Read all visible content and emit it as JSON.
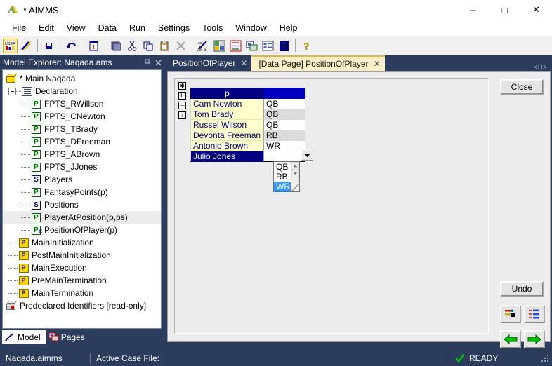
{
  "window": {
    "title": "* AIMMS",
    "app_icon": "aimms-logo-icon",
    "minimize": "─",
    "maximize": "□",
    "close": "✕"
  },
  "menu": {
    "items": [
      {
        "label": "File"
      },
      {
        "label": "Edit"
      },
      {
        "label": "View"
      },
      {
        "label": "Data"
      },
      {
        "label": "Run"
      },
      {
        "label": "Settings"
      },
      {
        "label": "Tools"
      },
      {
        "label": "Window"
      },
      {
        "label": "Help"
      }
    ]
  },
  "toolbar": {
    "groups": [
      {
        "buttons": [
          {
            "name": "user-colors-icon",
            "glyph": "USER",
            "selected": true
          },
          {
            "name": "pencil-tools-icon",
            "glyph": "✎"
          },
          {
            "name": "save-all-icon",
            "glyph": "⍈"
          },
          {
            "name": "undo-icon",
            "glyph": "↶"
          }
        ]
      },
      {
        "buttons": [
          {
            "name": "new-page-icon",
            "glyph": "1"
          },
          {
            "name": "open-folder-icon",
            "glyph": "❐"
          },
          {
            "name": "cut-icon",
            "glyph": "✂"
          },
          {
            "name": "copy-icon",
            "glyph": "⧉"
          },
          {
            "name": "paste-icon",
            "glyph": "ὌB"
          },
          {
            "name": "delete-icon",
            "glyph": "✕"
          }
        ]
      },
      {
        "buttons": [
          {
            "name": "math-program-icon",
            "glyph": "Ax"
          },
          {
            "name": "identifier-grid-icon",
            "glyph": "▒"
          },
          {
            "name": "model-tree-icon",
            "glyph": "⊞"
          },
          {
            "name": "page-manager-icon",
            "glyph": "▣"
          },
          {
            "name": "list-view-icon",
            "glyph": "☰"
          },
          {
            "name": "info-icon",
            "glyph": "i"
          }
        ]
      },
      {
        "buttons": [
          {
            "name": "help-icon",
            "glyph": "?"
          }
        ]
      }
    ]
  },
  "explorer": {
    "title": "Model Explorer: Naqada.ams",
    "pin_icon": "pin-icon",
    "close_icon": "close-icon",
    "tree": [
      {
        "label": "* Main Naqada",
        "icon": "model-box-icon",
        "depth": 0,
        "expander": false,
        "selected": false
      },
      {
        "label": "Declaration",
        "icon": "declaration-icon",
        "depth": 1,
        "expander": true,
        "selected": false
      },
      {
        "label": "FPTS_RWillson",
        "icon": "parameter-icon",
        "depth": 2,
        "expander": false,
        "selected": false
      },
      {
        "label": "FPTS_CNewton",
        "icon": "parameter-icon",
        "depth": 2,
        "expander": false,
        "selected": false
      },
      {
        "label": "FPTS_TBrady",
        "icon": "parameter-icon",
        "depth": 2,
        "expander": false,
        "selected": false
      },
      {
        "label": "FPTS_DFreeman",
        "icon": "parameter-icon",
        "depth": 2,
        "expander": false,
        "selected": false
      },
      {
        "label": "FPTS_ABrown",
        "icon": "parameter-icon",
        "depth": 2,
        "expander": false,
        "selected": false
      },
      {
        "label": "FPTS_JJones",
        "icon": "parameter-icon",
        "depth": 2,
        "expander": false,
        "selected": false
      },
      {
        "label": "Players",
        "icon": "set-icon",
        "depth": 2,
        "expander": false,
        "selected": false
      },
      {
        "label": "FantasyPoints(p)",
        "icon": "parameter-icon",
        "depth": 2,
        "expander": false,
        "selected": false
      },
      {
        "label": "Positions",
        "icon": "set-icon",
        "depth": 2,
        "expander": false,
        "selected": false
      },
      {
        "label": "PlayerAtPosition(p,ps)",
        "icon": "parameter-icon",
        "depth": 2,
        "expander": false,
        "selected": true
      },
      {
        "label": "PositionOfPlayer(p)",
        "icon": "element-parameter-icon",
        "depth": 2,
        "expander": false,
        "selected": false
      },
      {
        "label": "MainInitialization",
        "icon": "procedure-icon",
        "depth": 1,
        "expander": false,
        "selected": false
      },
      {
        "label": "PostMainInitialization",
        "icon": "procedure-icon",
        "depth": 1,
        "expander": false,
        "selected": false
      },
      {
        "label": "MainExecution",
        "icon": "procedure-icon",
        "depth": 1,
        "expander": false,
        "selected": false
      },
      {
        "label": "PreMainTermination",
        "icon": "procedure-icon",
        "depth": 1,
        "expander": false,
        "selected": false
      },
      {
        "label": "MainTermination",
        "icon": "procedure-icon",
        "depth": 1,
        "expander": false,
        "selected": false
      },
      {
        "label": "Predeclared Identifiers [read-only]",
        "icon": "predeclared-box-icon",
        "depth": 0,
        "expander": false,
        "selected": false
      }
    ],
    "tabs": [
      {
        "label": "Model",
        "icon": "model-tab-icon",
        "active": true
      },
      {
        "label": "Pages",
        "icon": "pages-tab-icon",
        "active": false
      }
    ]
  },
  "document": {
    "tabs": [
      {
        "label": "PositionOfPlayer",
        "active": false,
        "close": "✕"
      },
      {
        "label": "[Data Page] PositionOfPlayer",
        "active": true,
        "close": "✕"
      }
    ],
    "nav_prev": "◁",
    "nav_next": "▷"
  },
  "data_page": {
    "corner_buttons": [
      {
        "name": "table-select-all-button",
        "glyph": "✱"
      },
      {
        "name": "table-layout-button",
        "glyph": "L"
      },
      {
        "name": "table-collapse-button",
        "glyph": "−"
      },
      {
        "name": "table-expand-button",
        "glyph": "›"
      }
    ],
    "table": {
      "index_header": "p",
      "value_header": "",
      "rows": [
        {
          "name": "Cam Newton",
          "value": "QB",
          "selected": false
        },
        {
          "name": "Tom Brady",
          "value": "QB",
          "selected": false
        },
        {
          "name": "Russel Wilson",
          "value": "QB",
          "selected": false
        },
        {
          "name": "Devonta Freeman",
          "value": "RB",
          "selected": false
        },
        {
          "name": "Antonio Brown",
          "value": "WR",
          "selected": false
        },
        {
          "name": "Julio Jones",
          "value": "",
          "selected": true
        }
      ]
    },
    "dropdown": {
      "open": true,
      "arrow": "▼",
      "options": [
        {
          "label": "QB",
          "selected": false
        },
        {
          "label": "RB",
          "selected": false
        },
        {
          "label": "WR",
          "selected": true
        }
      ],
      "scroll_up": "▲",
      "scroll_down": "▼"
    },
    "buttons": {
      "close": "Close",
      "undo": "Undo"
    },
    "tools": [
      {
        "name": "insert-row-button",
        "glyph": "▬"
      },
      {
        "name": "data-properties-button",
        "glyph": "≡"
      }
    ],
    "nav": [
      {
        "name": "previous-record-button",
        "glyph": "←"
      },
      {
        "name": "next-record-button",
        "glyph": "→"
      }
    ]
  },
  "statusbar": {
    "project_file": "Naqada.aimms",
    "case_label": "Active Case File:",
    "case_value": "",
    "status_icon": "check-icon",
    "status": "READY"
  },
  "colors": {
    "chrome": "#2b3c5c",
    "accent_navy": "#000080",
    "accent_blue": "#0000c0",
    "row_cream": "#ffffcc",
    "active_tab": "#fdf0c8",
    "highlight": "#3399ff",
    "ready_green": "#00a000"
  }
}
